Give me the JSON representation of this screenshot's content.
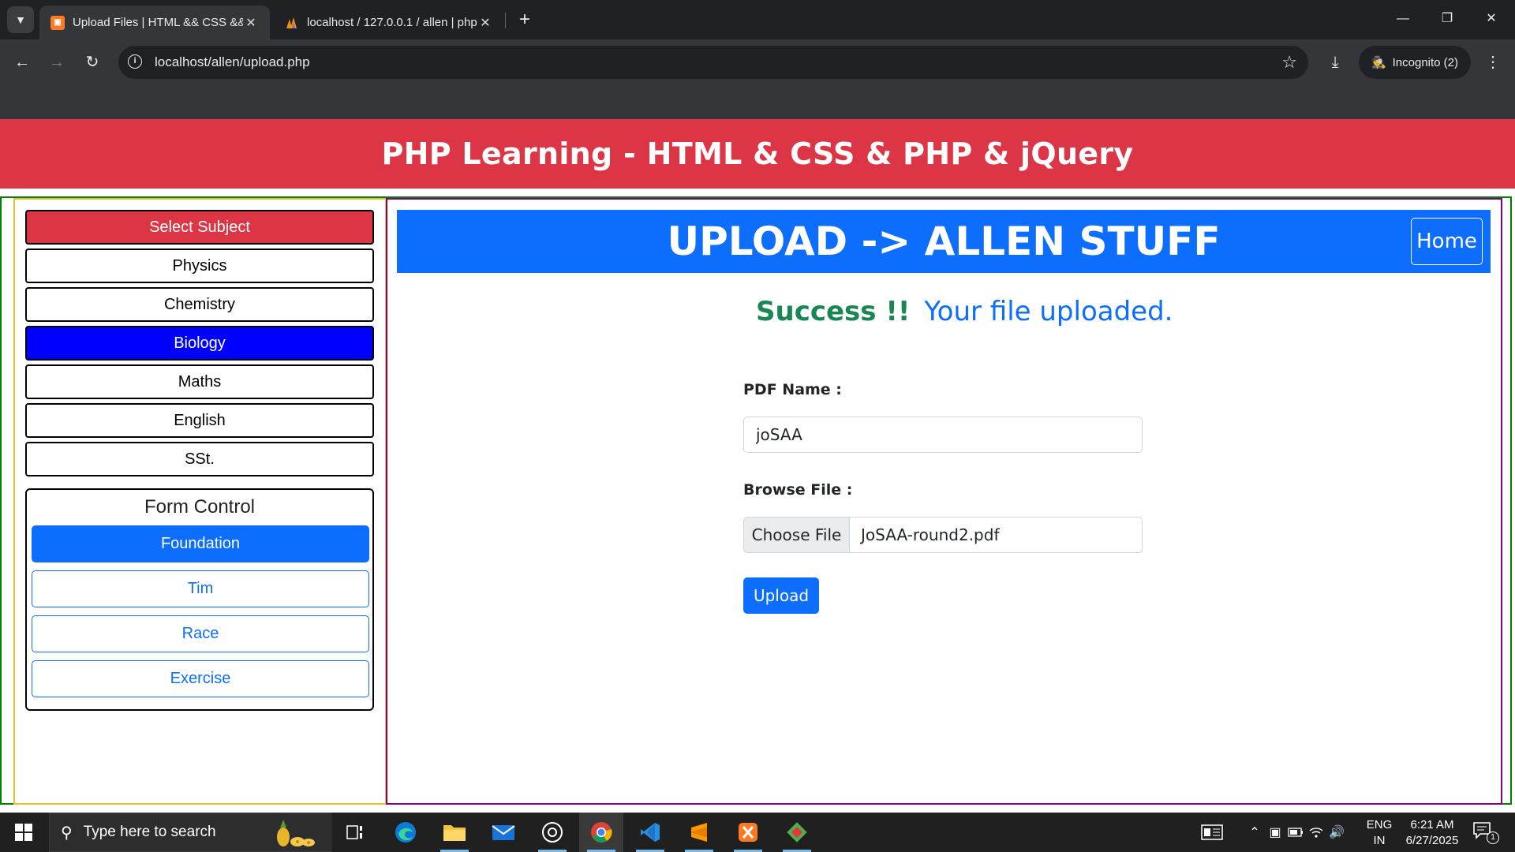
{
  "browser": {
    "tabs": [
      {
        "title": "Upload Files | HTML && CSS &&",
        "active": true,
        "favicon": "xampp-icon"
      },
      {
        "title": "localhost / 127.0.0.1 / allen | php",
        "active": false,
        "favicon": "phpmyadmin-icon"
      }
    ],
    "url": "localhost/allen/upload.php",
    "incognito_label": "Incognito (2)"
  },
  "page": {
    "header_title": "PHP Learning - HTML & CSS & PHP & jQuery",
    "sidebar": {
      "subjects": [
        {
          "label": "Select Subject",
          "style": "red"
        },
        {
          "label": "Physics",
          "style": "plain"
        },
        {
          "label": "Chemistry",
          "style": "plain"
        },
        {
          "label": "Biology",
          "style": "blue"
        },
        {
          "label": "Maths",
          "style": "plain"
        },
        {
          "label": "English",
          "style": "plain"
        },
        {
          "label": "SSt.",
          "style": "plain"
        }
      ],
      "form_control": {
        "title": "Form Control",
        "items": [
          {
            "label": "Foundation",
            "selected": true
          },
          {
            "label": "Tim",
            "selected": false
          },
          {
            "label": "Race",
            "selected": false
          },
          {
            "label": "Exercise",
            "selected": false
          }
        ]
      }
    },
    "main": {
      "banner_title": "UPLOAD -> ALLEN STUFF",
      "home_label": "Home",
      "success_prefix": "Success !!",
      "success_message": "Your file uploaded.",
      "pdf_name_label": "PDF Name :",
      "pdf_name_value": "joSAA",
      "browse_label": "Browse File :",
      "choose_file_label": "Choose File",
      "chosen_file_name": "JoSAA-round2.pdf",
      "upload_label": "Upload"
    }
  },
  "taskbar": {
    "search_placeholder": "Type here to search",
    "language_line1": "ENG",
    "language_line2": "IN",
    "time": "6:21 AM",
    "date": "6/27/2025",
    "notification_count": "1",
    "apps": [
      "task-view-icon",
      "edge-icon",
      "file-explorer-icon",
      "mail-icon",
      "chatgpt-icon",
      "chrome-icon",
      "vscode-icon",
      "sublime-icon",
      "xampp-icon",
      "git-icon"
    ]
  },
  "colors": {
    "header_red": "#dc3545",
    "bootstrap_blue": "#0d6efd",
    "pure_blue": "#0000ff",
    "success_green": "#198754",
    "outer_border": "#008000",
    "sidebar_border": "#e6c229",
    "main_border": "#800080"
  }
}
